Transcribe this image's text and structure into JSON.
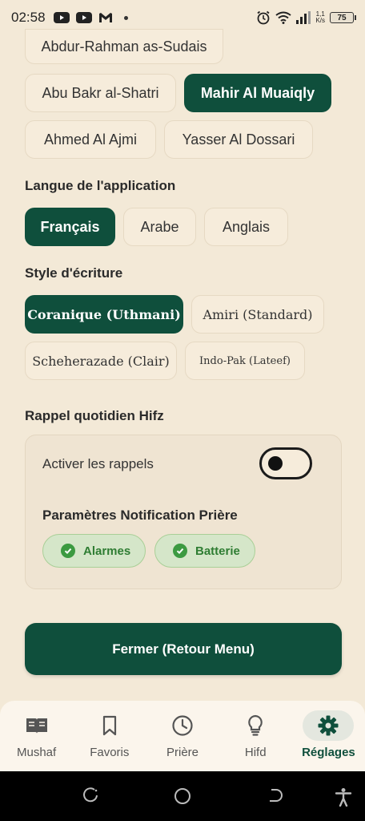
{
  "status_bar": {
    "time": "02:58",
    "net_speed_value": "1,1",
    "net_speed_unit": "K/s",
    "battery": "75"
  },
  "reciters": [
    {
      "label": "Abdur-Rahman as-Sudais",
      "selected": false
    },
    {
      "label": "Abu Bakr al-Shatri",
      "selected": false
    },
    {
      "label": "Mahir Al Muaiqly",
      "selected": true
    },
    {
      "label": "Ahmed Al Ajmi",
      "selected": false
    },
    {
      "label": "Yasser Al Dossari",
      "selected": false
    }
  ],
  "language": {
    "title": "Langue de l'application",
    "options": [
      {
        "label": "Français",
        "selected": true
      },
      {
        "label": "Arabe",
        "selected": false
      },
      {
        "label": "Anglais",
        "selected": false
      }
    ]
  },
  "writing_style": {
    "title": "Style d'écriture",
    "options": [
      {
        "label": "Coranique (Uthmani)",
        "selected": true
      },
      {
        "label": "Amiri (Standard)",
        "selected": false
      },
      {
        "label": "Scheherazade (Clair)",
        "selected": false
      },
      {
        "label": "Indo-Pak (Lateef)",
        "selected": false
      }
    ]
  },
  "hifz_reminder": {
    "title": "Rappel quotidien Hifz",
    "toggle_label": "Activer les rappels",
    "toggle_on": false,
    "notif_title": "Paramètres Notification Prière",
    "badges": [
      {
        "label": "Alarmes",
        "icon": "check-circle-icon"
      },
      {
        "label": "Batterie",
        "icon": "check-circle-icon"
      }
    ]
  },
  "close_button": "Fermer (Retour Menu)",
  "bottom_nav": [
    {
      "label": "Mushaf",
      "icon": "book-icon",
      "active": false
    },
    {
      "label": "Favoris",
      "icon": "bookmark-icon",
      "active": false
    },
    {
      "label": "Prière",
      "icon": "clock-icon",
      "active": false
    },
    {
      "label": "Hifd",
      "icon": "lightbulb-icon",
      "active": false
    },
    {
      "label": "Réglages",
      "icon": "gear-icon",
      "active": true
    }
  ],
  "colors": {
    "primary": "#0f4f3c",
    "background": "#f3e9d7",
    "success": "#3c9a41"
  }
}
